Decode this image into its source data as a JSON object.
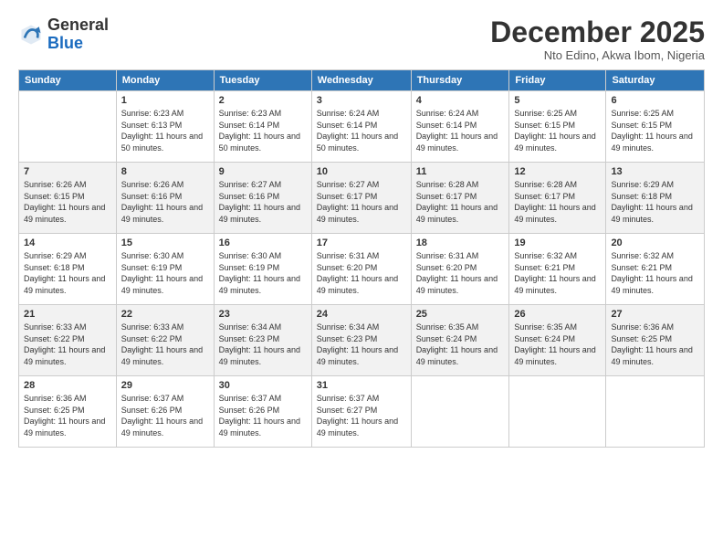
{
  "header": {
    "logo_general": "General",
    "logo_blue": "Blue",
    "month": "December 2025",
    "location": "Nto Edino, Akwa Ibom, Nigeria"
  },
  "days": [
    "Sunday",
    "Monday",
    "Tuesday",
    "Wednesday",
    "Thursday",
    "Friday",
    "Saturday"
  ],
  "weeks": [
    [
      {
        "date": "",
        "sunrise": "",
        "sunset": "",
        "daylight": ""
      },
      {
        "date": "1",
        "sunrise": "Sunrise: 6:23 AM",
        "sunset": "Sunset: 6:13 PM",
        "daylight": "Daylight: 11 hours and 50 minutes."
      },
      {
        "date": "2",
        "sunrise": "Sunrise: 6:23 AM",
        "sunset": "Sunset: 6:14 PM",
        "daylight": "Daylight: 11 hours and 50 minutes."
      },
      {
        "date": "3",
        "sunrise": "Sunrise: 6:24 AM",
        "sunset": "Sunset: 6:14 PM",
        "daylight": "Daylight: 11 hours and 50 minutes."
      },
      {
        "date": "4",
        "sunrise": "Sunrise: 6:24 AM",
        "sunset": "Sunset: 6:14 PM",
        "daylight": "Daylight: 11 hours and 49 minutes."
      },
      {
        "date": "5",
        "sunrise": "Sunrise: 6:25 AM",
        "sunset": "Sunset: 6:15 PM",
        "daylight": "Daylight: 11 hours and 49 minutes."
      },
      {
        "date": "6",
        "sunrise": "Sunrise: 6:25 AM",
        "sunset": "Sunset: 6:15 PM",
        "daylight": "Daylight: 11 hours and 49 minutes."
      }
    ],
    [
      {
        "date": "7",
        "sunrise": "Sunrise: 6:26 AM",
        "sunset": "Sunset: 6:15 PM",
        "daylight": "Daylight: 11 hours and 49 minutes."
      },
      {
        "date": "8",
        "sunrise": "Sunrise: 6:26 AM",
        "sunset": "Sunset: 6:16 PM",
        "daylight": "Daylight: 11 hours and 49 minutes."
      },
      {
        "date": "9",
        "sunrise": "Sunrise: 6:27 AM",
        "sunset": "Sunset: 6:16 PM",
        "daylight": "Daylight: 11 hours and 49 minutes."
      },
      {
        "date": "10",
        "sunrise": "Sunrise: 6:27 AM",
        "sunset": "Sunset: 6:17 PM",
        "daylight": "Daylight: 11 hours and 49 minutes."
      },
      {
        "date": "11",
        "sunrise": "Sunrise: 6:28 AM",
        "sunset": "Sunset: 6:17 PM",
        "daylight": "Daylight: 11 hours and 49 minutes."
      },
      {
        "date": "12",
        "sunrise": "Sunrise: 6:28 AM",
        "sunset": "Sunset: 6:17 PM",
        "daylight": "Daylight: 11 hours and 49 minutes."
      },
      {
        "date": "13",
        "sunrise": "Sunrise: 6:29 AM",
        "sunset": "Sunset: 6:18 PM",
        "daylight": "Daylight: 11 hours and 49 minutes."
      }
    ],
    [
      {
        "date": "14",
        "sunrise": "Sunrise: 6:29 AM",
        "sunset": "Sunset: 6:18 PM",
        "daylight": "Daylight: 11 hours and 49 minutes."
      },
      {
        "date": "15",
        "sunrise": "Sunrise: 6:30 AM",
        "sunset": "Sunset: 6:19 PM",
        "daylight": "Daylight: 11 hours and 49 minutes."
      },
      {
        "date": "16",
        "sunrise": "Sunrise: 6:30 AM",
        "sunset": "Sunset: 6:19 PM",
        "daylight": "Daylight: 11 hours and 49 minutes."
      },
      {
        "date": "17",
        "sunrise": "Sunrise: 6:31 AM",
        "sunset": "Sunset: 6:20 PM",
        "daylight": "Daylight: 11 hours and 49 minutes."
      },
      {
        "date": "18",
        "sunrise": "Sunrise: 6:31 AM",
        "sunset": "Sunset: 6:20 PM",
        "daylight": "Daylight: 11 hours and 49 minutes."
      },
      {
        "date": "19",
        "sunrise": "Sunrise: 6:32 AM",
        "sunset": "Sunset: 6:21 PM",
        "daylight": "Daylight: 11 hours and 49 minutes."
      },
      {
        "date": "20",
        "sunrise": "Sunrise: 6:32 AM",
        "sunset": "Sunset: 6:21 PM",
        "daylight": "Daylight: 11 hours and 49 minutes."
      }
    ],
    [
      {
        "date": "21",
        "sunrise": "Sunrise: 6:33 AM",
        "sunset": "Sunset: 6:22 PM",
        "daylight": "Daylight: 11 hours and 49 minutes."
      },
      {
        "date": "22",
        "sunrise": "Sunrise: 6:33 AM",
        "sunset": "Sunset: 6:22 PM",
        "daylight": "Daylight: 11 hours and 49 minutes."
      },
      {
        "date": "23",
        "sunrise": "Sunrise: 6:34 AM",
        "sunset": "Sunset: 6:23 PM",
        "daylight": "Daylight: 11 hours and 49 minutes."
      },
      {
        "date": "24",
        "sunrise": "Sunrise: 6:34 AM",
        "sunset": "Sunset: 6:23 PM",
        "daylight": "Daylight: 11 hours and 49 minutes."
      },
      {
        "date": "25",
        "sunrise": "Sunrise: 6:35 AM",
        "sunset": "Sunset: 6:24 PM",
        "daylight": "Daylight: 11 hours and 49 minutes."
      },
      {
        "date": "26",
        "sunrise": "Sunrise: 6:35 AM",
        "sunset": "Sunset: 6:24 PM",
        "daylight": "Daylight: 11 hours and 49 minutes."
      },
      {
        "date": "27",
        "sunrise": "Sunrise: 6:36 AM",
        "sunset": "Sunset: 6:25 PM",
        "daylight": "Daylight: 11 hours and 49 minutes."
      }
    ],
    [
      {
        "date": "28",
        "sunrise": "Sunrise: 6:36 AM",
        "sunset": "Sunset: 6:25 PM",
        "daylight": "Daylight: 11 hours and 49 minutes."
      },
      {
        "date": "29",
        "sunrise": "Sunrise: 6:37 AM",
        "sunset": "Sunset: 6:26 PM",
        "daylight": "Daylight: 11 hours and 49 minutes."
      },
      {
        "date": "30",
        "sunrise": "Sunrise: 6:37 AM",
        "sunset": "Sunset: 6:26 PM",
        "daylight": "Daylight: 11 hours and 49 minutes."
      },
      {
        "date": "31",
        "sunrise": "Sunrise: 6:37 AM",
        "sunset": "Sunset: 6:27 PM",
        "daylight": "Daylight: 11 hours and 49 minutes."
      },
      {
        "date": "",
        "sunrise": "",
        "sunset": "",
        "daylight": ""
      },
      {
        "date": "",
        "sunrise": "",
        "sunset": "",
        "daylight": ""
      },
      {
        "date": "",
        "sunrise": "",
        "sunset": "",
        "daylight": ""
      }
    ]
  ]
}
